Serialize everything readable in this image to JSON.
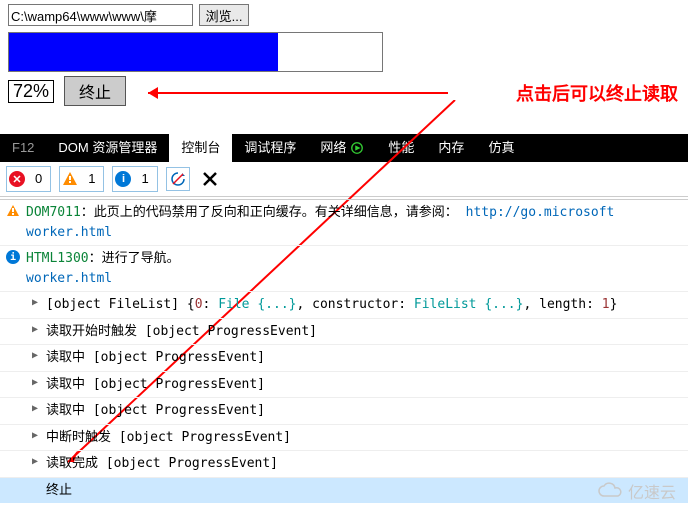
{
  "filePath": "C:\\wamp64\\www\\www\\摩",
  "browseLabel": "浏览...",
  "progressPercent": 72,
  "percentText": "72%",
  "stopLabel": "终止",
  "annotation": "点击后可以终止读取",
  "tabs": {
    "f12": "F12",
    "dom": "DOM 资源管理器",
    "console": "控制台",
    "debugger": "调试程序",
    "network": "网络",
    "performance": "性能",
    "memory": "内存",
    "emulation": "仿真"
  },
  "counts": {
    "errors": "0",
    "warnings": "1",
    "info": "1"
  },
  "msg1": {
    "code": "DOM7011",
    "text": "：此页上的代码禁用了反向和正向缓存。有关详细信息，请参阅：",
    "url": "http://go.microsoft",
    "sub": "worker.html"
  },
  "msg2": {
    "code": "HTML1300",
    "text": "：进行了导航。",
    "sub": "worker.html"
  },
  "obj": {
    "pre": "[object FileList]    {",
    "k0": "0",
    "file": "File {...}",
    "mid": ", constructor: ",
    "fl": "FileList {...}",
    "len": ", length: ",
    "one": "1",
    "end": "}"
  },
  "rows": {
    "r1": "读取开始时触发 [object ProgressEvent]",
    "r2": "读取中 [object ProgressEvent]",
    "r3": "读取中 [object ProgressEvent]",
    "r4": "读取中 [object ProgressEvent]",
    "r5": "中断时触发 [object ProgressEvent]",
    "r6": "读取完成 [object ProgressEvent]",
    "r7": "终止"
  },
  "watermark": "亿速云"
}
